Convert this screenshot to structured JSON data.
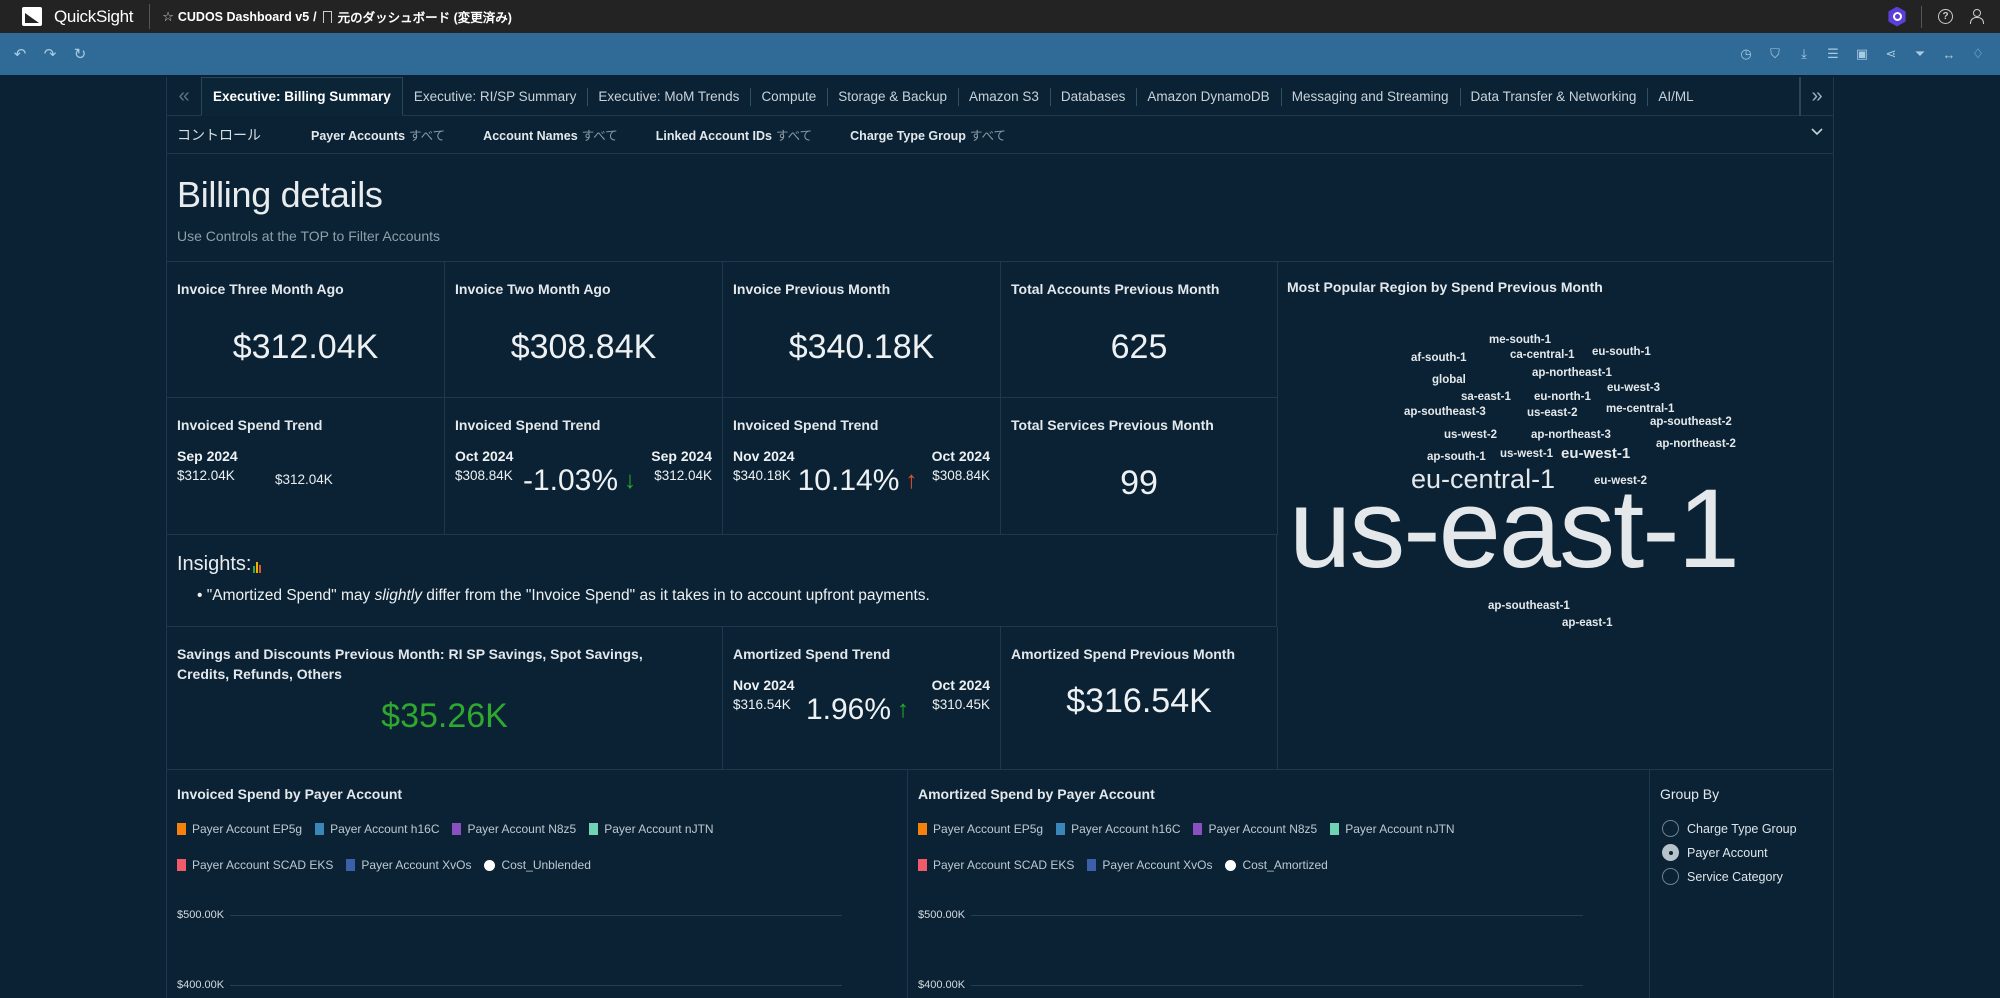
{
  "app": {
    "name": "QuickSight",
    "dashboard_name": "CUDOS Dashboard v5",
    "separator": "/",
    "analysis_name": "元のダッシュボード (変更済み)"
  },
  "topbar_icons": [
    "app-badge-icon",
    "help-icon",
    "user-icon"
  ],
  "toolbar": {
    "left_icons": [
      "undo-icon",
      "redo-icon",
      "reset-icon"
    ],
    "right_icons": [
      "history-icon",
      "bookmark-icon",
      "export-icon",
      "dataset-icon",
      "save-icon",
      "share-icon",
      "filter-icon",
      "fit-width-icon",
      "alert-icon"
    ]
  },
  "tabs": [
    {
      "label": "Executive: Billing Summary",
      "active": true
    },
    {
      "label": "Executive: RI/SP Summary",
      "active": false
    },
    {
      "label": "Executive: MoM Trends",
      "active": false
    },
    {
      "label": "Compute",
      "active": false
    },
    {
      "label": "Storage & Backup",
      "active": false
    },
    {
      "label": "Amazon S3",
      "active": false
    },
    {
      "label": "Databases",
      "active": false
    },
    {
      "label": "Amazon DynamoDB",
      "active": false
    },
    {
      "label": "Messaging and Streaming",
      "active": false
    },
    {
      "label": "Data Transfer & Networking",
      "active": false
    },
    {
      "label": "AI/ML",
      "active": false
    }
  ],
  "controls": {
    "title": "コントロール",
    "items": [
      {
        "label": "Payer Accounts",
        "value": "すべて"
      },
      {
        "label": "Account Names",
        "value": "すべて"
      },
      {
        "label": "Linked Account IDs",
        "value": "すべて"
      },
      {
        "label": "Charge Type Group",
        "value": "すべて"
      }
    ]
  },
  "header": {
    "title": "Billing details",
    "subtitle": "Use Controls at the TOP to Filter Accounts"
  },
  "kpis": {
    "invoice_3m": {
      "title": "Invoice Three Month Ago",
      "value": "$312.04K"
    },
    "invoice_2m": {
      "title": "Invoice Two Month Ago",
      "value": "$308.84K"
    },
    "invoice_prev": {
      "title": "Invoice Previous Month",
      "value": "$340.18K"
    },
    "total_accounts": {
      "title": "Total Accounts Previous Month",
      "value": "625"
    },
    "total_services": {
      "title": "Total Services Previous Month",
      "value": "99"
    },
    "savings": {
      "title": "Savings and Discounts Previous Month: RI SP Savings, Spot Savings, Credits, Refunds, Others",
      "value": "$35.26K",
      "color": "#2ea82e"
    },
    "amortized_prev": {
      "title": "Amortized Spend Previous Month",
      "value": "$316.54K"
    }
  },
  "trends": {
    "t1": {
      "title": "Invoiced Spend Trend",
      "left_month": "Sep 2024",
      "left_value": "$312.04K",
      "center_value": "$312.04K"
    },
    "t2": {
      "title": "Invoiced Spend Trend",
      "left_month": "Oct 2024",
      "left_value": "$308.84K",
      "pct": "-1.03%",
      "direction": "down",
      "right_month": "Sep 2024",
      "right_value": "$312.04K"
    },
    "t3": {
      "title": "Invoiced Spend Trend",
      "left_month": "Nov 2024",
      "left_value": "$340.18K",
      "pct": "10.14%",
      "direction": "up",
      "right_month": "Oct 2024",
      "right_value": "$308.84K"
    },
    "t4": {
      "title": "Amortized Spend Trend",
      "left_month": "Nov 2024",
      "left_value": "$316.54K",
      "pct": "1.96%",
      "direction": "up",
      "right_month": "Oct 2024",
      "right_value": "$310.45K"
    }
  },
  "insights": {
    "heading": "Insights:",
    "bullet": "•",
    "text_before": "\"Amortized Spend\" may ",
    "text_em": "slightly",
    "text_after": " differ from the \"Invoice Spend\" as it takes in to account upfront payments."
  },
  "region_cloud": {
    "title": "Most Popular Region by Spend Previous Month",
    "words": [
      {
        "text": "me-south-1",
        "rank": "small"
      },
      {
        "text": "af-south-1",
        "rank": "small"
      },
      {
        "text": "ca-central-1",
        "rank": "small"
      },
      {
        "text": "eu-south-1",
        "rank": "small"
      },
      {
        "text": "global",
        "rank": "small"
      },
      {
        "text": "ap-northeast-1",
        "rank": "small"
      },
      {
        "text": "sa-east-1",
        "rank": "small"
      },
      {
        "text": "eu-north-1",
        "rank": "small"
      },
      {
        "text": "eu-west-3",
        "rank": "small"
      },
      {
        "text": "ap-southeast-3",
        "rank": "small"
      },
      {
        "text": "us-east-2",
        "rank": "small"
      },
      {
        "text": "me-central-1",
        "rank": "small"
      },
      {
        "text": "ap-southeast-2",
        "rank": "small"
      },
      {
        "text": "us-west-2",
        "rank": "small"
      },
      {
        "text": "ap-northeast-3",
        "rank": "small"
      },
      {
        "text": "ap-northeast-2",
        "rank": "small"
      },
      {
        "text": "ap-south-1",
        "rank": "small"
      },
      {
        "text": "us-west-1",
        "rank": "small"
      },
      {
        "text": "eu-west-1",
        "rank": "medium"
      },
      {
        "text": "eu-central-1",
        "rank": "large"
      },
      {
        "text": "eu-west-2",
        "rank": "small"
      },
      {
        "text": "us-east-1",
        "rank": "largest"
      },
      {
        "text": "ap-southeast-1",
        "rank": "small"
      },
      {
        "text": "ap-east-1",
        "rank": "small"
      }
    ]
  },
  "charts": [
    {
      "title": "Invoiced Spend by Payer Account",
      "legend": [
        {
          "label": "Payer Account EP5g",
          "color": "#f5820d",
          "shape": "square"
        },
        {
          "label": "Payer Account h16C",
          "color": "#3a86b8",
          "shape": "square"
        },
        {
          "label": "Payer Account N8z5",
          "color": "#8a4fc0",
          "shape": "square"
        },
        {
          "label": "Payer Account nJTN",
          "color": "#6fd3b4",
          "shape": "square"
        },
        {
          "label": "Payer Account SCAD EKS",
          "color": "#ef5b6b",
          "shape": "square"
        },
        {
          "label": "Payer Account XvOs",
          "color": "#3b5fa8",
          "shape": "square"
        },
        {
          "label": "Cost_Unblended",
          "color": "#ffffff",
          "shape": "circle"
        }
      ],
      "y_ticks": [
        "$500.00K",
        "$400.00K"
      ]
    },
    {
      "title": "Amortized Spend by Payer Account",
      "legend": [
        {
          "label": "Payer Account EP5g",
          "color": "#f5820d",
          "shape": "square"
        },
        {
          "label": "Payer Account h16C",
          "color": "#3a86b8",
          "shape": "square"
        },
        {
          "label": "Payer Account N8z5",
          "color": "#8a4fc0",
          "shape": "square"
        },
        {
          "label": "Payer Account nJTN",
          "color": "#6fd3b4",
          "shape": "square"
        },
        {
          "label": "Payer Account SCAD EKS",
          "color": "#ef5b6b",
          "shape": "square"
        },
        {
          "label": "Payer Account XvOs",
          "color": "#3b5fa8",
          "shape": "square"
        },
        {
          "label": "Cost_Amortized",
          "color": "#ffffff",
          "shape": "circle"
        }
      ],
      "y_ticks": [
        "$500.00K",
        "$400.00K"
      ]
    }
  ],
  "group_by": {
    "title": "Group By",
    "options": [
      {
        "label": "Charge Type Group",
        "selected": false
      },
      {
        "label": "Payer Account",
        "selected": true
      },
      {
        "label": "Service Category",
        "selected": false
      }
    ]
  }
}
